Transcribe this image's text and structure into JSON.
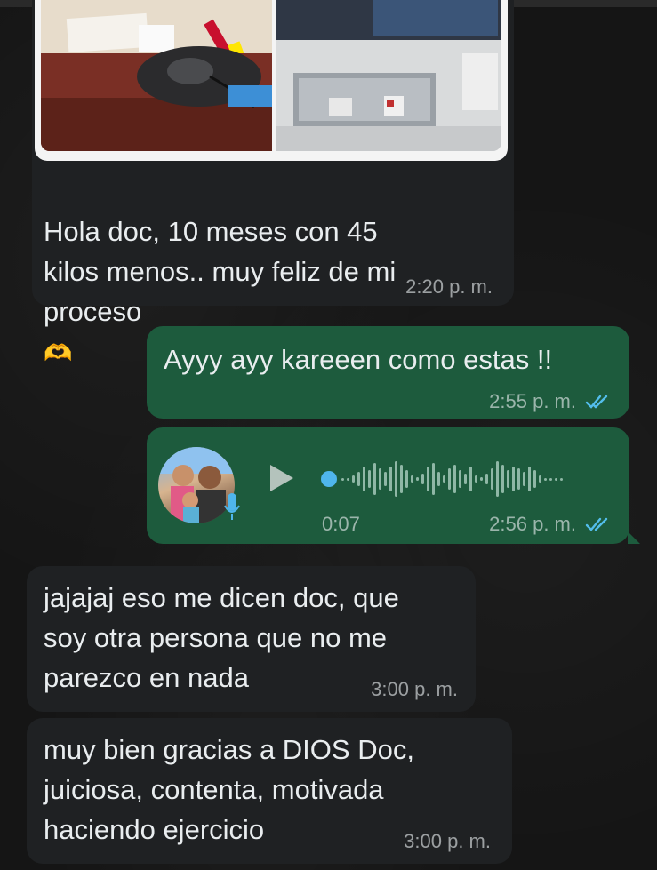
{
  "messages": [
    {
      "text": "Hola doc, 10 meses con 45\nkilos menos.. muy feliz de mi\nproceso",
      "emoji": "🫶",
      "time": "2:20 p. m."
    },
    {
      "text": "Ayyy ayy kareeen como estas !!",
      "time": "2:55 p. m."
    },
    {
      "voice_duration": "0:07",
      "time": "2:56 p. m."
    },
    {
      "text": "jajajaj eso me dicen doc, que\nsoy otra persona que no me\nparezco en nada",
      "time": "3:00 p. m."
    },
    {
      "text": "muy bien gracias a DIOS Doc,\njuiciosa, contenta, motivada\nhaciendo ejercicio",
      "time": "3:00 p. m."
    }
  ],
  "colors": {
    "incoming_bubble": "#1f2123",
    "outgoing_bubble": "#1d5b3d",
    "read_ticks": "#53bdeb",
    "voice_dot": "#4fb6ec"
  },
  "icons": {
    "play": "play-icon",
    "mic": "microphone-icon",
    "ticks": "double-check-icon"
  }
}
